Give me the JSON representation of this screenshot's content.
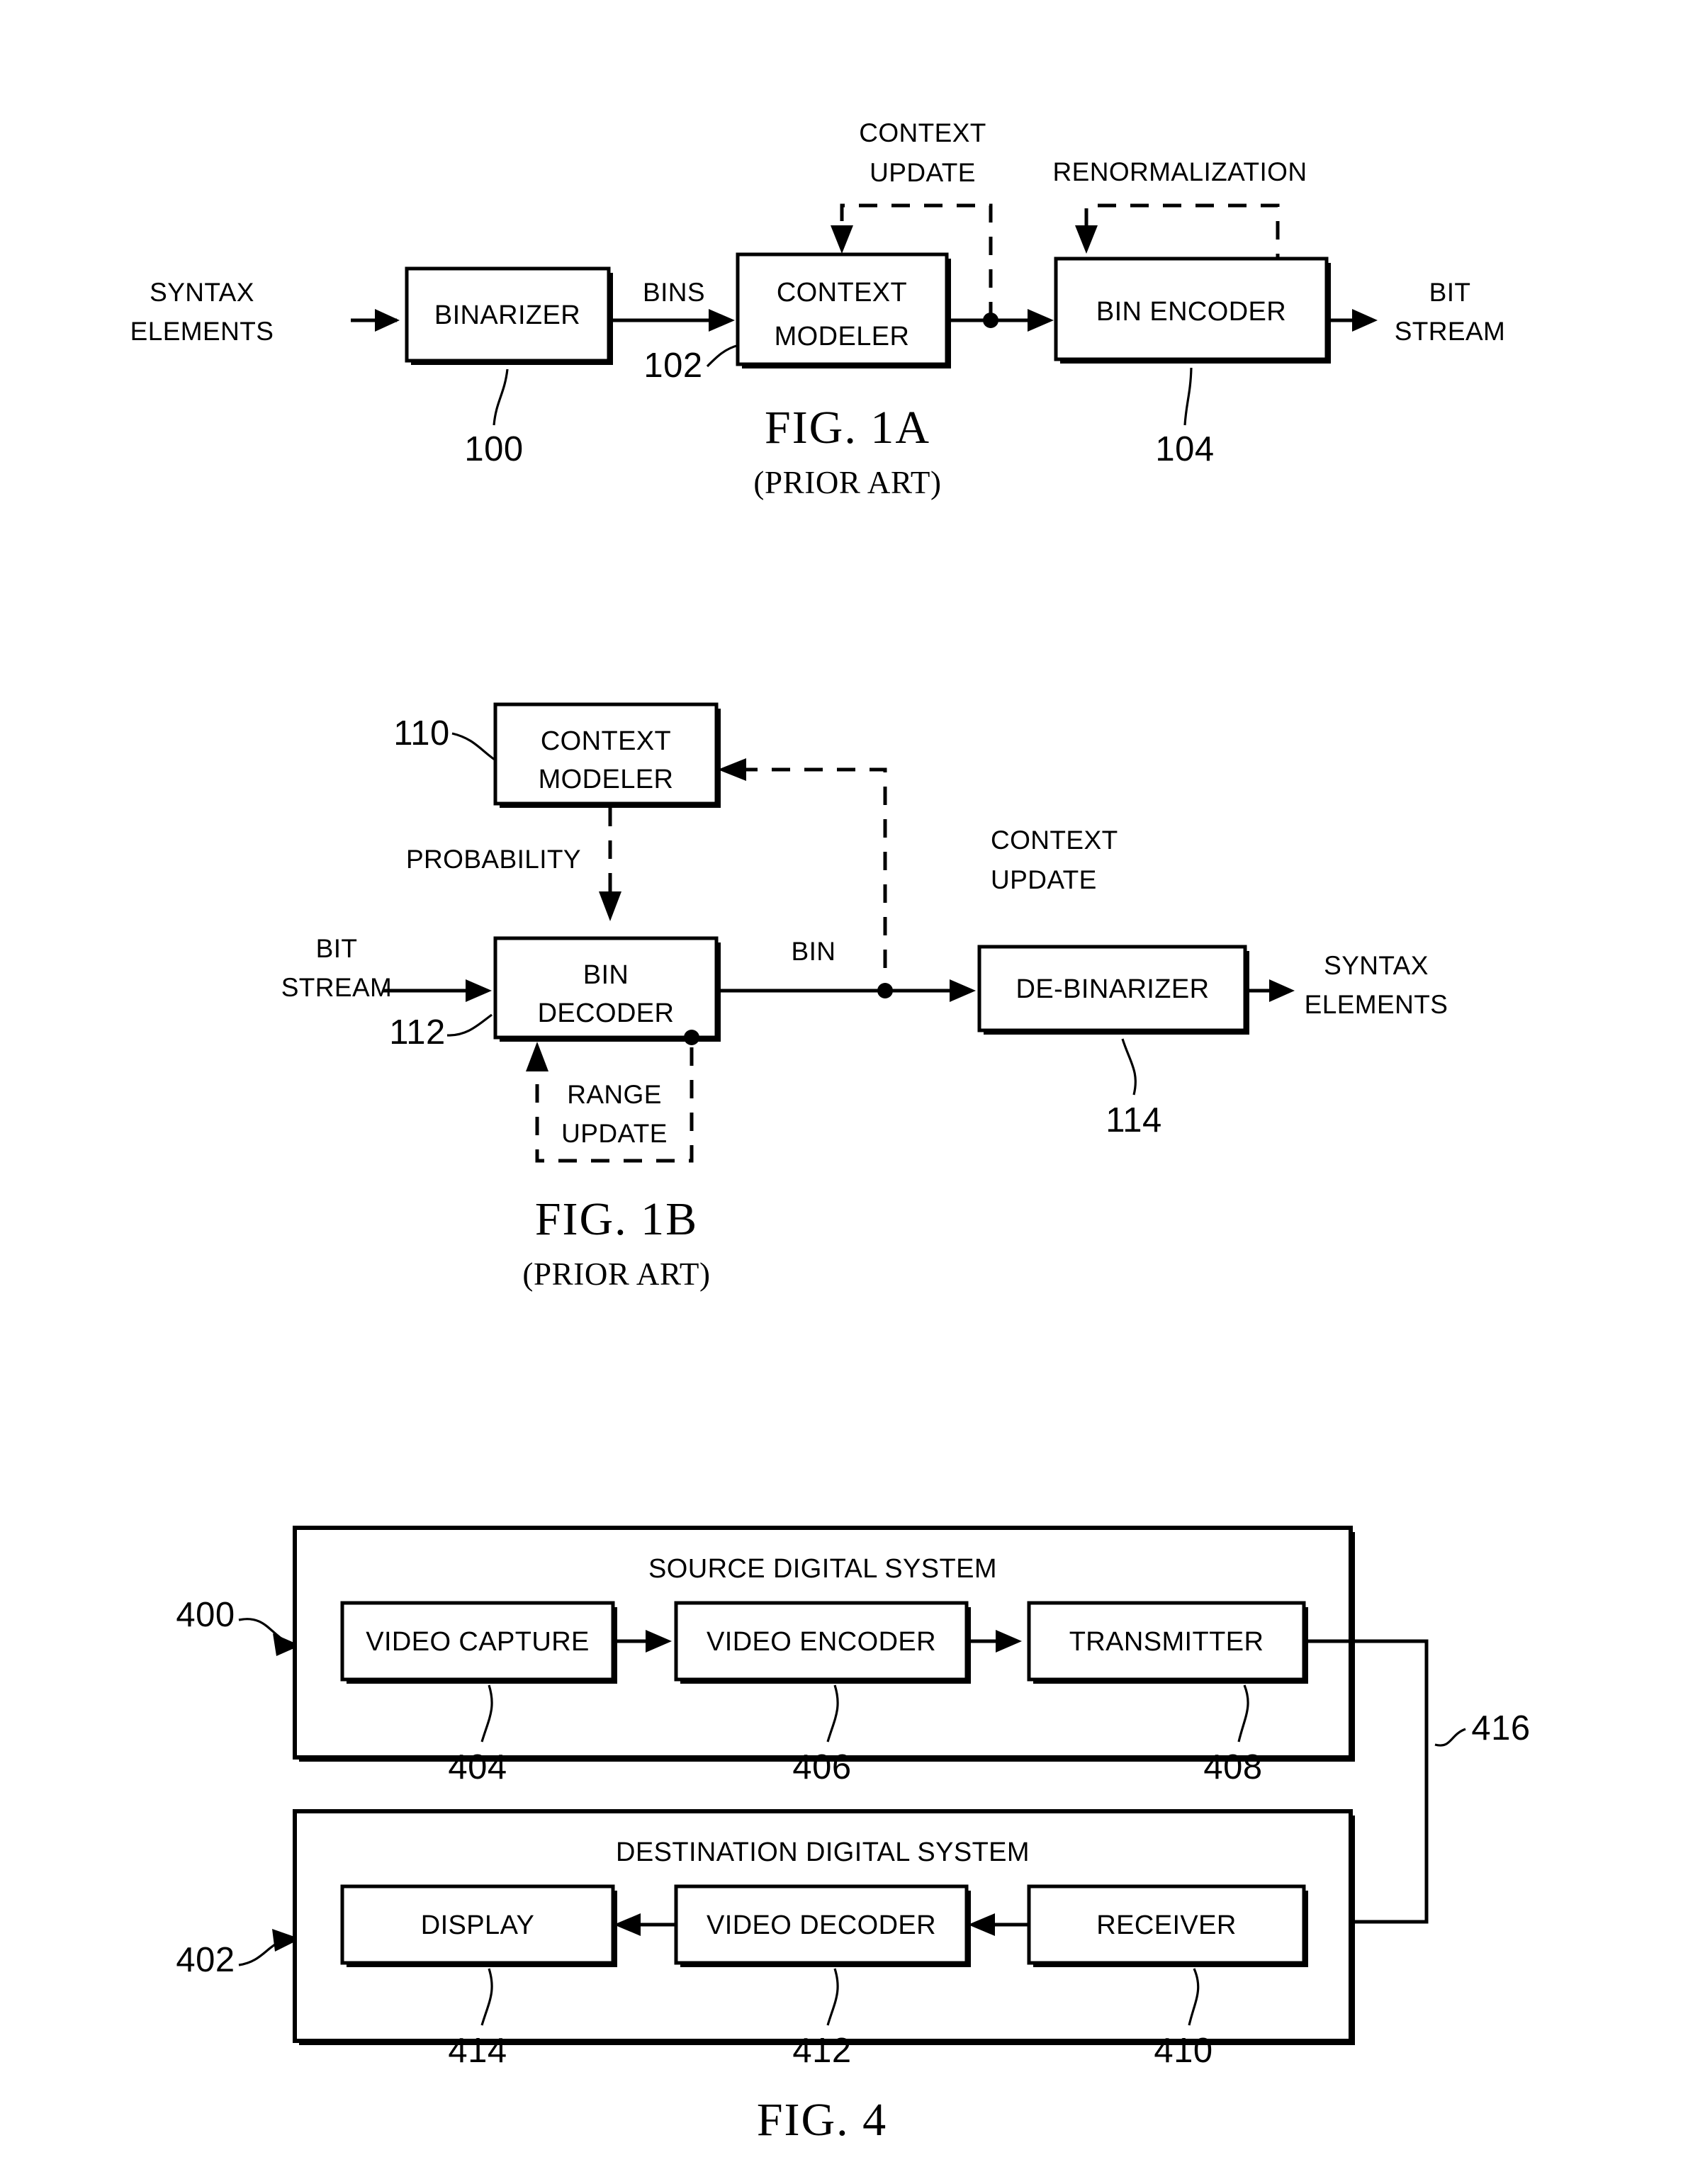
{
  "document": {
    "kind": "patent-drawing-sheet",
    "figures": [
      {
        "id": "fig1a",
        "caption": "FIG. 1A",
        "subcaption": "(PRIOR ART)",
        "boxes": [
          {
            "id": "binarizer",
            "label": "BINARIZER",
            "ref": "100"
          },
          {
            "id": "context-modeler",
            "label_line1": "CONTEXT",
            "label_line2": "MODELER",
            "ref": "102"
          },
          {
            "id": "bin-encoder",
            "label": "BIN ENCODER",
            "ref": "104"
          }
        ],
        "signals": [
          {
            "id": "syntax-elements-in",
            "line1": "SYNTAX",
            "line2": "ELEMENTS"
          },
          {
            "id": "bins",
            "label": "BINS"
          },
          {
            "id": "bit-stream-out",
            "line1": "BIT",
            "line2": "STREAM"
          },
          {
            "id": "context-update",
            "line1": "CONTEXT",
            "line2": "UPDATE"
          },
          {
            "id": "renormalization",
            "label": "RENORMALIZATION"
          }
        ]
      },
      {
        "id": "fig1b",
        "caption": "FIG. 1B",
        "subcaption": "(PRIOR ART)",
        "boxes": [
          {
            "id": "context-modeler",
            "label_line1": "CONTEXT",
            "label_line2": "MODELER",
            "ref": "110"
          },
          {
            "id": "bin-decoder",
            "label_line1": "BIN",
            "label_line2": "DECODER",
            "ref": "112"
          },
          {
            "id": "de-binarizer",
            "label": "DE-BINARIZER",
            "ref": "114"
          }
        ],
        "signals": [
          {
            "id": "bit-stream-in",
            "line1": "BIT",
            "line2": "STREAM"
          },
          {
            "id": "probability",
            "label": "PROBABILITY"
          },
          {
            "id": "bin",
            "label": "BIN"
          },
          {
            "id": "context-update",
            "line1": "CONTEXT",
            "line2": "UPDATE"
          },
          {
            "id": "range-update",
            "line1": "RANGE",
            "line2": "UPDATE"
          },
          {
            "id": "syntax-elements-out",
            "line1": "SYNTAX",
            "line2": "ELEMENTS"
          }
        ]
      },
      {
        "id": "fig4",
        "caption": "FIG. 4",
        "subcaption": "",
        "systems": [
          {
            "id": "source-digital-system",
            "title": "SOURCE DIGITAL SYSTEM",
            "ref": "400",
            "boxes": [
              {
                "id": "video-capture",
                "label": "VIDEO CAPTURE",
                "ref": "404"
              },
              {
                "id": "video-encoder",
                "label": "VIDEO ENCODER",
                "ref": "406"
              },
              {
                "id": "transmitter",
                "label": "TRANSMITTER",
                "ref": "408"
              }
            ]
          },
          {
            "id": "destination-digital-system",
            "title": "DESTINATION DIGITAL SYSTEM",
            "ref": "402",
            "boxes": [
              {
                "id": "display",
                "label": "DISPLAY",
                "ref": "414"
              },
              {
                "id": "video-decoder",
                "label": "VIDEO DECODER",
                "ref": "412"
              },
              {
                "id": "receiver",
                "label": "RECEIVER",
                "ref": "410"
              }
            ]
          }
        ],
        "links": [
          {
            "id": "communication-channel",
            "ref": "416"
          }
        ]
      }
    ]
  },
  "colors": {
    "ink": "#000000",
    "paper": "#ffffff"
  }
}
